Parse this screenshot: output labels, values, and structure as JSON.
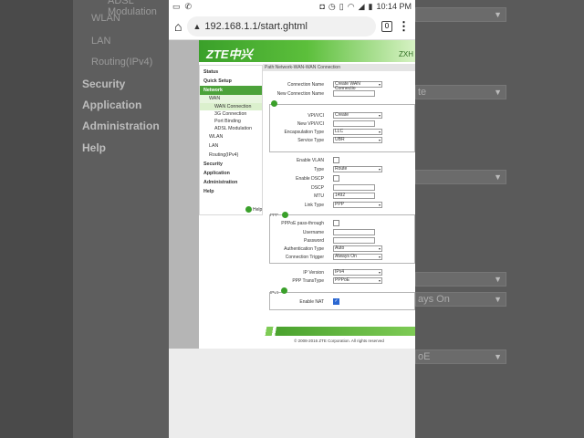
{
  "background_left": {
    "items": [
      {
        "label": "ADSL Modulation",
        "bold": false
      },
      {
        "label": "WLAN",
        "bold": false
      },
      {
        "label": "LAN",
        "bold": false
      },
      {
        "label": "Routing(IPv4)",
        "bold": false
      },
      {
        "label": "Security",
        "bold": true
      },
      {
        "label": "Application",
        "bold": true
      },
      {
        "label": "Administration",
        "bold": true
      },
      {
        "label": "Help",
        "bold": true
      }
    ]
  },
  "background_right": {
    "selects": [
      "",
      "",
      "te",
      "",
      "",
      "",
      "",
      "ays On",
      "",
      "oE"
    ]
  },
  "status_bar": {
    "time": "10:14 PM",
    "battery": "94"
  },
  "browser": {
    "url": "192.168.1.1/start.ghtml",
    "tab_count": "0"
  },
  "router": {
    "brand": "ZTE中兴",
    "model": "ZXH",
    "path": "Path:Network-WAN-WAN Connection",
    "sidebar": {
      "items": [
        {
          "label": "Status",
          "kind": "bold"
        },
        {
          "label": "Quick Setup",
          "kind": "bold"
        },
        {
          "label": "Network",
          "kind": "sel"
        },
        {
          "label": "WAN",
          "kind": "sub"
        },
        {
          "label": "WAN Connection",
          "kind": "subsub-active"
        },
        {
          "label": "3G Connection",
          "kind": "subsub"
        },
        {
          "label": "Port Binding",
          "kind": "subsub"
        },
        {
          "label": "ADSL Modulation",
          "kind": "subsub"
        },
        {
          "label": "WLAN",
          "kind": "lvl1"
        },
        {
          "label": "LAN",
          "kind": "lvl1"
        },
        {
          "label": "Routing(IPv4)",
          "kind": "lvl1"
        },
        {
          "label": "Security",
          "kind": "bold"
        },
        {
          "label": "Application",
          "kind": "bold"
        },
        {
          "label": "Administration",
          "kind": "bold"
        },
        {
          "label": "Help",
          "kind": "bold"
        }
      ],
      "help_label": "Help"
    },
    "form": {
      "connection_name": {
        "label": "Connection Name",
        "value": "Create WAN Connectio"
      },
      "new_connection_name": {
        "label": "New Connection Name",
        "value": ""
      },
      "vpi_vci": {
        "label": "VPI/VCI",
        "value": "Create"
      },
      "new_vpi_vci": {
        "label": "New VPI/VCI",
        "value": ""
      },
      "encapsulation": {
        "label": "Encapsulation Type",
        "value": "LLC"
      },
      "service_type": {
        "label": "Service Type",
        "value": "UBR"
      },
      "enable_vlan": {
        "label": "Enable VLAN"
      },
      "type": {
        "label": "Type",
        "value": "Route"
      },
      "enable_dscp": {
        "label": "Enable DSCP"
      },
      "dscp": {
        "label": "DSCP",
        "value": ""
      },
      "mtu": {
        "label": "MTU",
        "value": "1492"
      },
      "link_type": {
        "label": "Link Type",
        "value": "PPP"
      },
      "ppp_legend": "PPP",
      "pppoe_passthrough": {
        "label": "PPPoE pass-through"
      },
      "username": {
        "label": "Username",
        "value": ""
      },
      "password": {
        "label": "Password",
        "value": ""
      },
      "auth_type": {
        "label": "Authentication Type",
        "value": "Auto"
      },
      "conn_trigger": {
        "label": "Connection Trigger",
        "value": "Always On"
      },
      "ip_version": {
        "label": "IP Version",
        "value": "IPv4"
      },
      "ppp_transtype": {
        "label": "PPP TransType",
        "value": "PPPoE"
      },
      "ipv4_legend": "IPv4",
      "enable_nat": {
        "label": "Enable NAT",
        "checked": true
      }
    },
    "copyright": "© 2008-2016 ZTE Corporation. All rights reserved"
  }
}
